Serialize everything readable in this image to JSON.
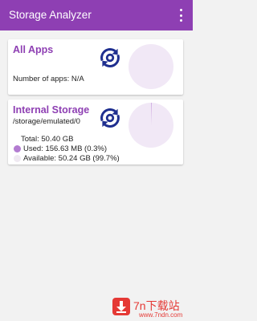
{
  "appbar": {
    "title": "Storage Analyzer",
    "menu_icon": "overflow-menu-icon"
  },
  "all_apps": {
    "title": "All Apps",
    "apps_label": "Number of apps: N/A",
    "refresh_icon": "refresh-icon"
  },
  "internal_storage": {
    "title": "Internal Storage",
    "path": "/storage/emulated/0",
    "refresh_icon": "refresh-icon",
    "total": "Total: 50.40 GB",
    "used": "Used: 156.63 MB (0.3%)",
    "available": "Available: 50.24 GB (99.7%)",
    "used_fraction": 0.003
  },
  "colors": {
    "accent": "#8e3fb3",
    "refresh_icon": "#1f2f8f",
    "pie_fill": "#f1e8f6",
    "used_color": "#b37cd1",
    "available_color": "#efe9f1"
  },
  "watermark": {
    "text": "7n下载站",
    "url": "www.7ndn.com"
  }
}
